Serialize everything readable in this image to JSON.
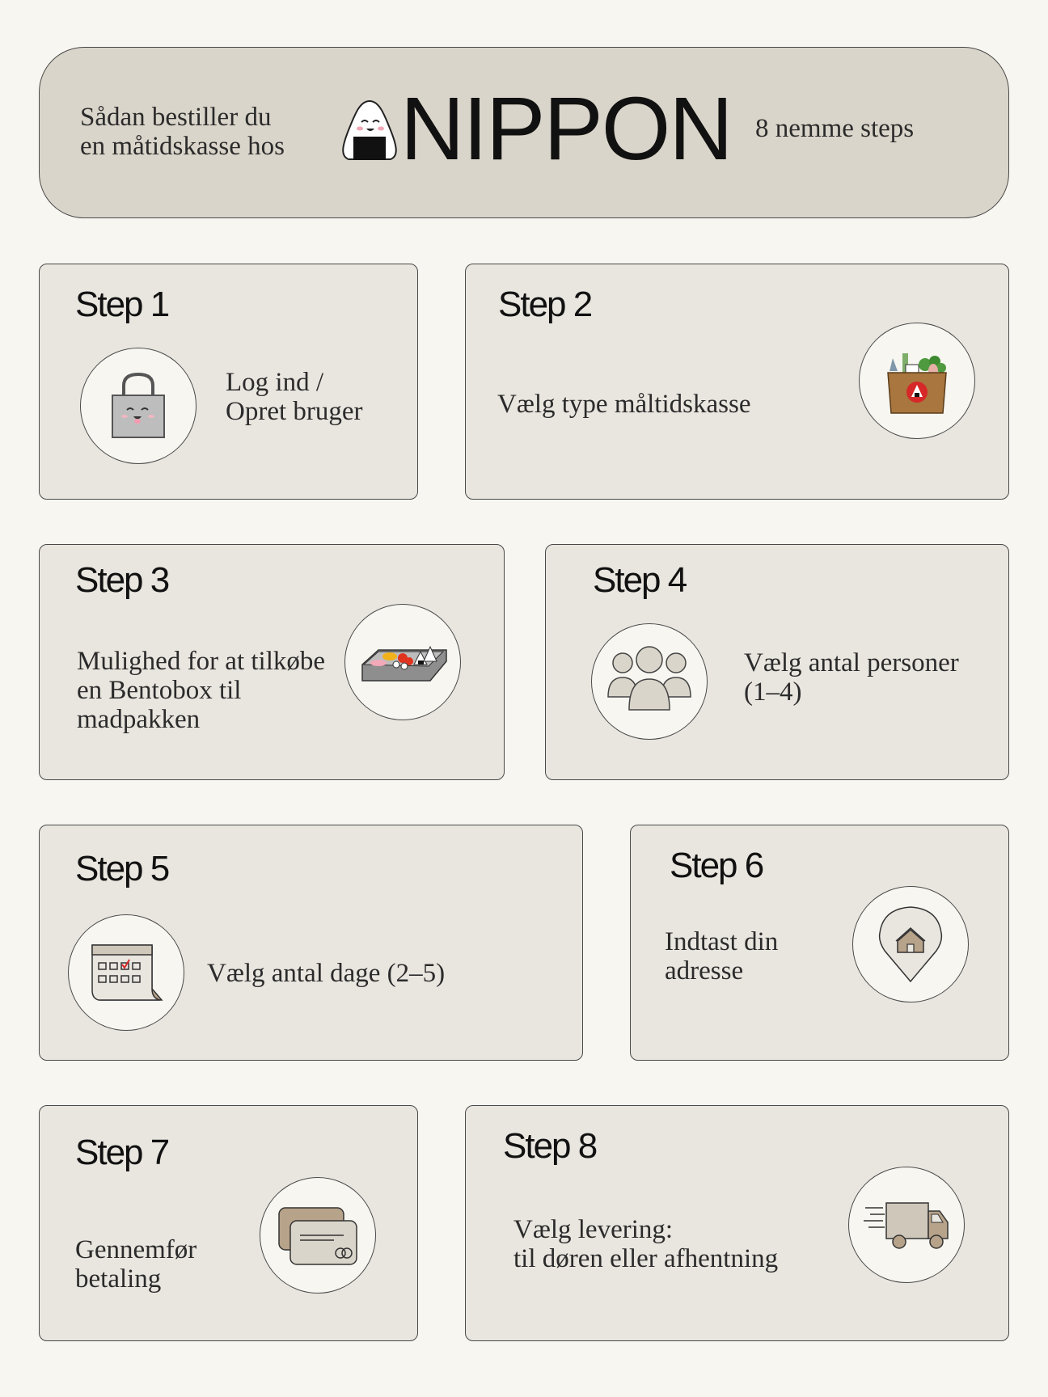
{
  "header": {
    "intro_line1": "Sådan bestiller du",
    "intro_line2": "en måtidskasse hos",
    "brand": "NIPPON",
    "subtitle": "8 nemme steps"
  },
  "steps": [
    {
      "title": "Step 1",
      "text": "Log ind /\nOpret bruger",
      "icon": "shopping-bag-icon"
    },
    {
      "title": "Step 2",
      "text": "Vælg type måltidskasse",
      "icon": "grocery-box-icon"
    },
    {
      "title": "Step 3",
      "text": "Mulighed for at tilkøbe\nen Bentobox til\nmadpakken",
      "icon": "bento-box-icon"
    },
    {
      "title": "Step 4",
      "text": "Vælg antal personer\n(1–4)",
      "icon": "people-icon"
    },
    {
      "title": "Step 5",
      "text": "Vælg antal dage (2–5)",
      "icon": "calendar-icon"
    },
    {
      "title": "Step 6",
      "text": "Indtast din\nadresse",
      "icon": "location-pin-icon"
    },
    {
      "title": "Step 7",
      "text": "Gennemfør\nbetaling",
      "icon": "credit-card-icon"
    },
    {
      "title": "Step 8",
      "text": "Vælg levering:\ntil døren eller afhentning",
      "icon": "delivery-truck-icon"
    }
  ],
  "colors": {
    "background": "#f7f6f1",
    "header": "#dad5ca",
    "card": "#e9e5df",
    "accent_red": "#d62828"
  }
}
